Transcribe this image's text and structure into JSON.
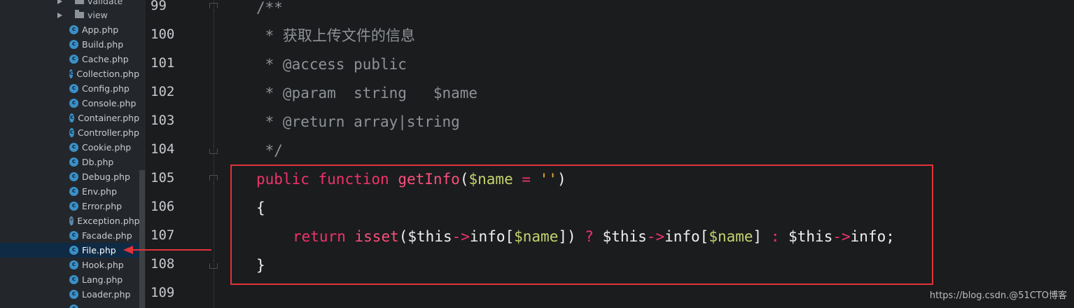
{
  "sidebar": {
    "folders": [
      {
        "label": "validate"
      },
      {
        "label": "view"
      }
    ],
    "files": [
      {
        "label": "App.php",
        "icon": "class-icon",
        "selected": false
      },
      {
        "label": "Build.php",
        "icon": "class-icon",
        "selected": false
      },
      {
        "label": "Cache.php",
        "icon": "class-icon",
        "selected": false
      },
      {
        "label": "Collection.php",
        "icon": "class-icon",
        "selected": false
      },
      {
        "label": "Config.php",
        "icon": "class-icon",
        "selected": false
      },
      {
        "label": "Console.php",
        "icon": "class-icon",
        "selected": false
      },
      {
        "label": "Container.php",
        "icon": "class-icon",
        "selected": false
      },
      {
        "label": "Controller.php",
        "icon": "class-icon",
        "selected": false
      },
      {
        "label": "Cookie.php",
        "icon": "class-icon",
        "selected": false
      },
      {
        "label": "Db.php",
        "icon": "class-icon",
        "selected": false
      },
      {
        "label": "Debug.php",
        "icon": "class-icon",
        "selected": false
      },
      {
        "label": "Env.php",
        "icon": "class-icon",
        "selected": false
      },
      {
        "label": "Error.php",
        "icon": "class-icon",
        "selected": false
      },
      {
        "label": "Exception.php",
        "icon": "exception-icon",
        "selected": false
      },
      {
        "label": "Facade.php",
        "icon": "class-icon",
        "selected": false
      },
      {
        "label": "File.php",
        "icon": "class-icon",
        "selected": true
      },
      {
        "label": "Hook.php",
        "icon": "class-icon",
        "selected": false
      },
      {
        "label": "Lang.php",
        "icon": "class-icon",
        "selected": false
      },
      {
        "label": "Loader.php",
        "icon": "class-icon",
        "selected": false
      }
    ]
  },
  "editor": {
    "line_numbers": [
      "99",
      "100",
      "101",
      "102",
      "103",
      "104",
      "105",
      "106",
      "107",
      "108",
      "109"
    ],
    "lines": {
      "l99": "/**",
      "l100": " * 获取上传文件的信息",
      "l101": " * @access public",
      "l102": " * @param  string   $name",
      "l103": " * @return array|string",
      "l104": " */",
      "l105": {
        "kw1": "public",
        "kw2": "function",
        "fn": "getInfo",
        "p1": "(",
        "var": "$name",
        "eq": " = ",
        "str": "''",
        "p2": ")"
      },
      "l106": "{",
      "l107": {
        "kw": "return",
        "fn": "isset",
        "p1": "(",
        "this1": "$this",
        "arr1": "->",
        "prop1": "info[",
        "var1": "$name",
        "c1": "])",
        "q": " ? ",
        "this2": "$this",
        "arr2": "->",
        "prop2": "info[",
        "var2": "$name",
        "c2": "]",
        "colon": " : ",
        "this3": "$this",
        "arr3": "->",
        "prop3": "info;"
      },
      "l108": "}"
    }
  },
  "watermark": "https://blog.csdn.@51CTO博客",
  "colors": {
    "keyword": "#f0336b",
    "function": "#fb4f7c",
    "variable": "#c5d36e",
    "string": "#f0b13a",
    "comment": "#8e9297",
    "annotation": "#e0333a"
  }
}
